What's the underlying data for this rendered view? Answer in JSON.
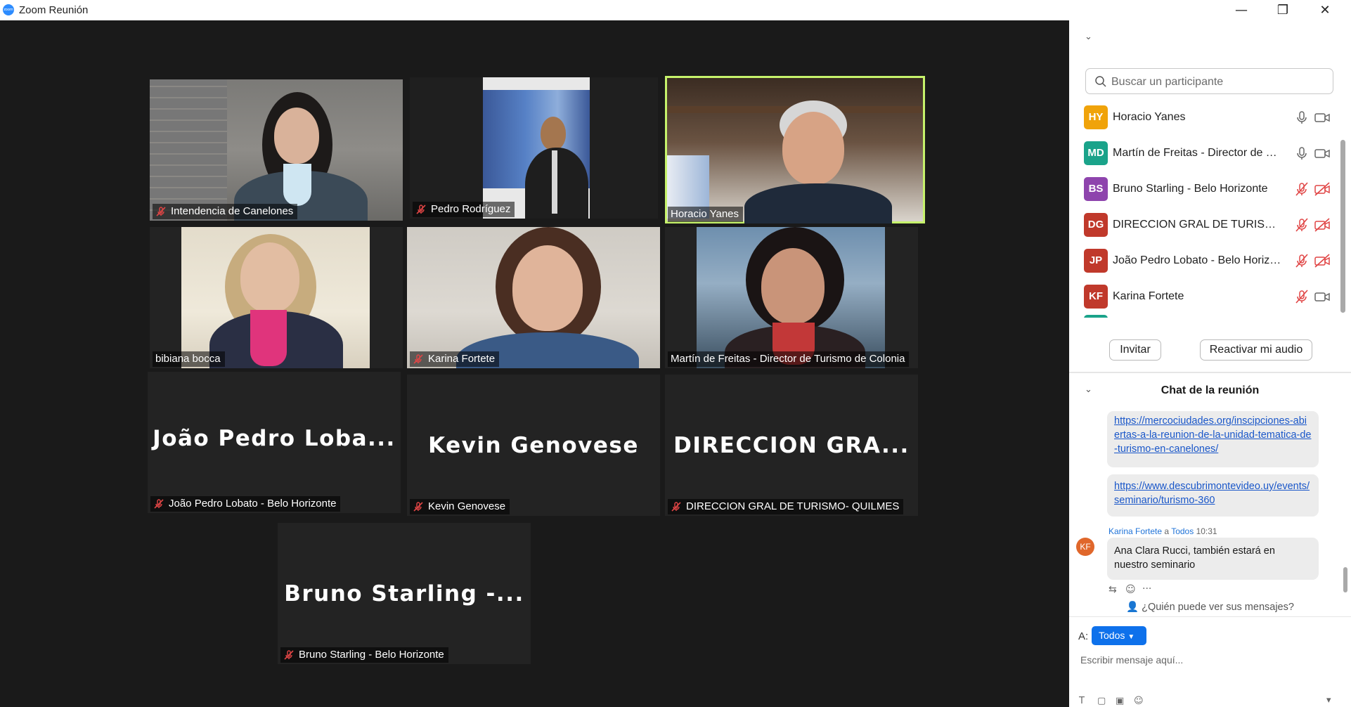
{
  "window": {
    "title": "Zoom Reunión",
    "app_icon_label": "zoom",
    "minimize": "—",
    "restore": "❐",
    "close": "✕"
  },
  "gallery": {
    "tiles": [
      {
        "label": "Intendencia de Canelones",
        "muted": true,
        "video": true
      },
      {
        "label": "Pedro Rodríguez",
        "muted": true,
        "video": true
      },
      {
        "label": "Horacio Yanes",
        "muted": false,
        "video": true,
        "active_speaker": true
      },
      {
        "label": "bibiana bocca",
        "muted": false,
        "video": true
      },
      {
        "label": "Karina Fortete",
        "muted": true,
        "video": true
      },
      {
        "label": "Martín de Freitas - Director de Turismo de Colonia",
        "muted": false,
        "video": true
      },
      {
        "big_name": "João Pedro Loba...",
        "label": "João Pedro Lobato - Belo Horizonte",
        "muted": true,
        "video": false
      },
      {
        "big_name": "Kevin Genovese",
        "label": "Kevin Genovese",
        "muted": true,
        "video": false
      },
      {
        "big_name": "DIRECCION GRA...",
        "label": "DIRECCION GRAL DE TURISMO- QUILMES",
        "muted": true,
        "video": false
      },
      {
        "big_name": "Bruno Starling -...",
        "label": "Bruno Starling - Belo Horizonte",
        "muted": true,
        "video": false
      }
    ]
  },
  "participants": {
    "search_placeholder": "Buscar un participante",
    "list": [
      {
        "initials": "HY",
        "name": "Horacio Yanes",
        "color": "#f0a30a",
        "mic": "on",
        "cam": "on"
      },
      {
        "initials": "MD",
        "name": "Martín de Freitas - Director de Tu...",
        "color": "#1aa38a",
        "mic": "on",
        "cam": "on"
      },
      {
        "initials": "BS",
        "name": "Bruno Starling - Belo Horizonte",
        "color": "#8e44ad",
        "mic": "off",
        "cam": "off"
      },
      {
        "initials": "DG",
        "name": "DIRECCION GRAL DE TURISMO- ...",
        "color": "#c0392b",
        "mic": "off",
        "cam": "off"
      },
      {
        "initials": "JP",
        "name": "João Pedro Lobato - Belo Horizo...",
        "color": "#c0392b",
        "mic": "off",
        "cam": "off"
      },
      {
        "initials": "KF",
        "name": "Karina Fortete",
        "color": "#c0392b",
        "mic": "off",
        "cam": "on"
      }
    ],
    "invite_label": "Invitar",
    "unmute_label": "Reactivar mi audio"
  },
  "chat": {
    "title": "Chat de la reunión",
    "messages": [
      {
        "type": "link",
        "text": "https://mercociudades.org/inscipciones-abiertas-a-la-reunion-de-la-unidad-tematica-de-turismo-en-canelones/"
      },
      {
        "type": "link",
        "text": "https://www.descubrimontevideo.uy/events/seminario/turismo-360"
      },
      {
        "type": "text",
        "sender": "Karina Fortete",
        "to_word": "a",
        "recipient": "Todos",
        "time": "10:31",
        "initials": "KF",
        "text": "Ana Clara Rucci, también estará en nuestro seminario"
      }
    ],
    "who_can_see": "¿Quién puede ver sus mensajes?",
    "to_label": "A:",
    "to_value": "Todos",
    "compose_placeholder": "Escribir mensaje aquí..."
  }
}
